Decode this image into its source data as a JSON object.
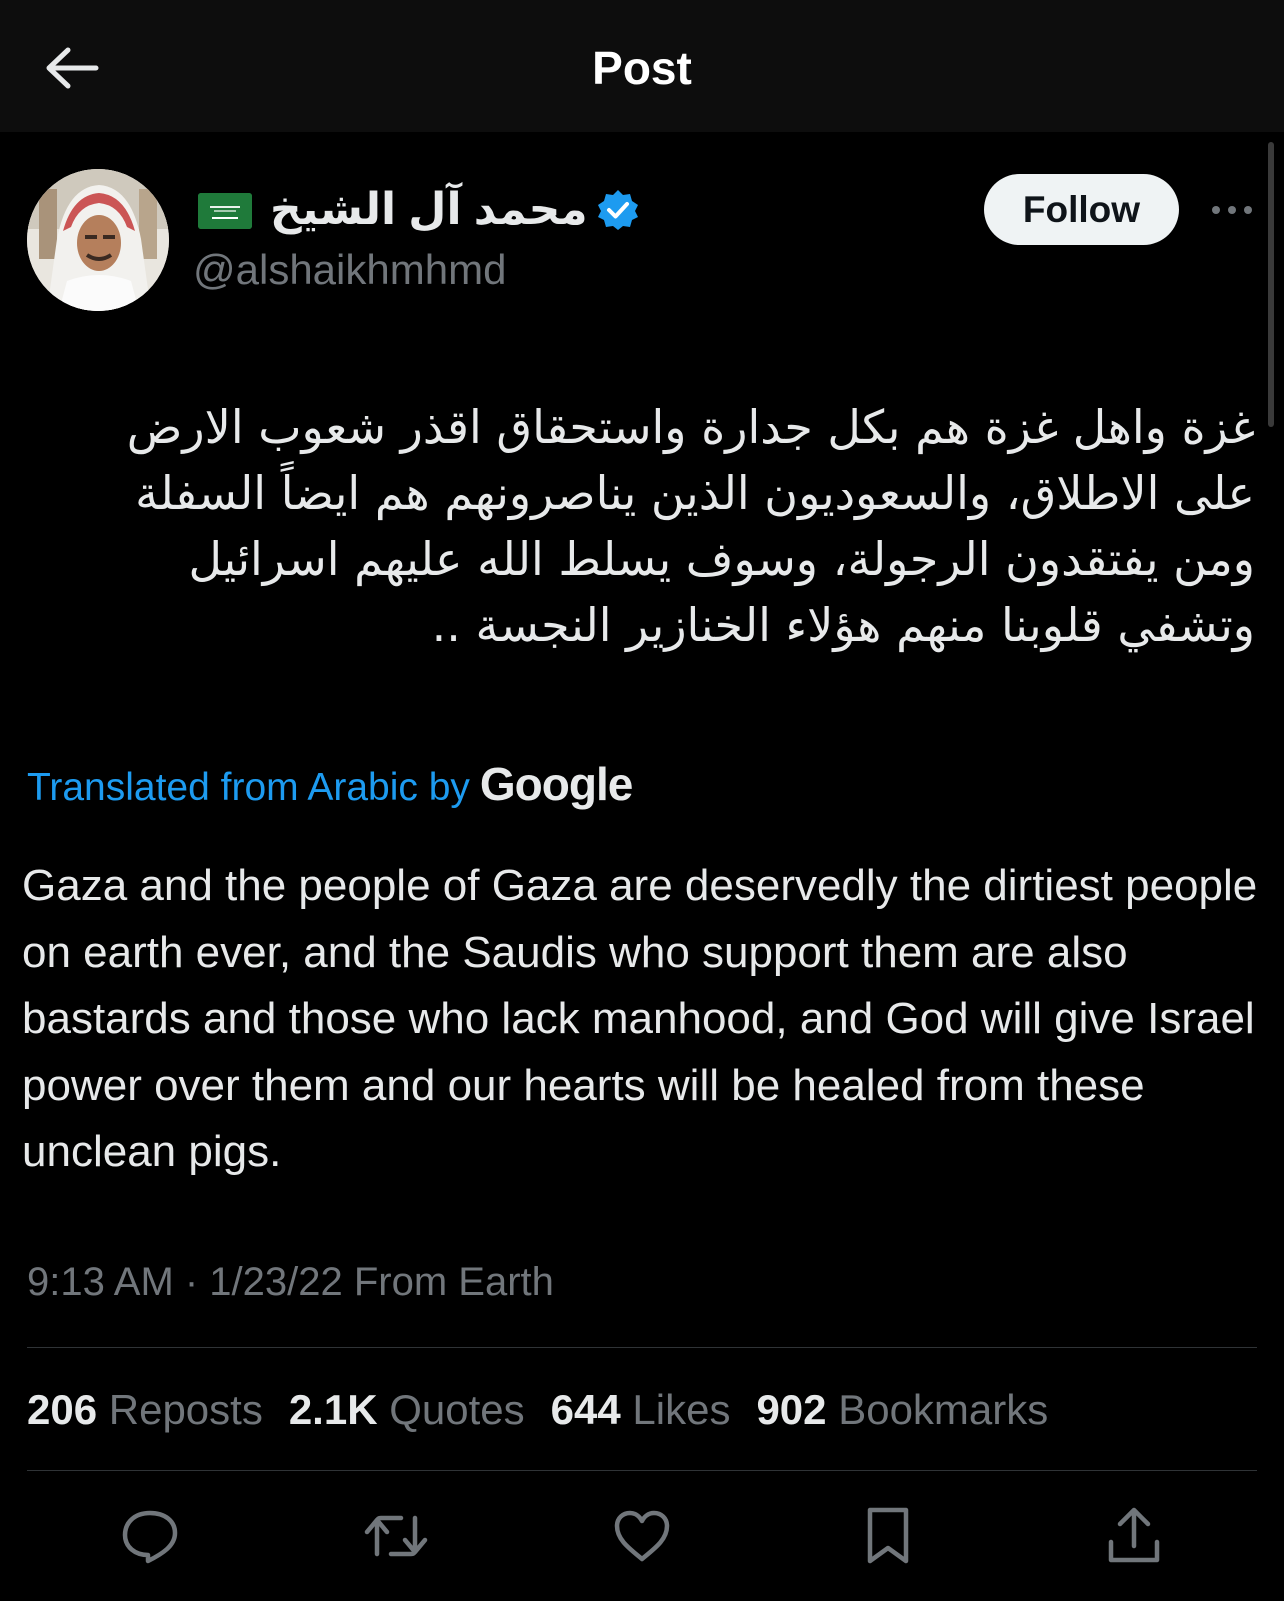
{
  "header": {
    "title": "Post"
  },
  "author": {
    "display_name": "محمد آل الشيخ",
    "handle": "@alshaikhmhmd",
    "flag": "saudi-flag",
    "verified": true
  },
  "follow_label": "Follow",
  "post": {
    "arabic_lines": [
      "غزة واهل غزة هم بكل جدارة واستحقاق اقذر  شعوب الارض",
      "على الاطلاق، والسعوديون الذين يناصرونهم هم ايضاً السفلة",
      "ومن يفتقدون الرجولة، وسوف يسلط الله عليهم اسرائيل",
      "وتشفي قلوبنا منهم هؤلاء الخنازير النجسة .."
    ],
    "translated_label": "Translated from Arabic by",
    "translated_provider": "Google",
    "english_text": "Gaza and the people of Gaza are deservedly the dirtiest people on earth ever, and the Saudis who support them are also bastards and those who lack manhood, and God will give Israel power over them and our hearts will be healed from these unclean pigs.",
    "timestamp": "9:13 AM · 1/23/22 From Earth"
  },
  "stats": [
    {
      "count": "206",
      "label": "Reposts"
    },
    {
      "count": "2.1K",
      "label": "Quotes"
    },
    {
      "count": "644",
      "label": "Likes"
    },
    {
      "count": "902",
      "label": "Bookmarks"
    }
  ],
  "actions": [
    "reply-icon",
    "repost-icon",
    "like-icon",
    "bookmark-icon",
    "share-icon"
  ],
  "colors": {
    "background": "#000000",
    "text": "#e7e9ea",
    "muted": "#71767b",
    "link": "#1d9bf0",
    "verified": "#1d9bf0"
  }
}
